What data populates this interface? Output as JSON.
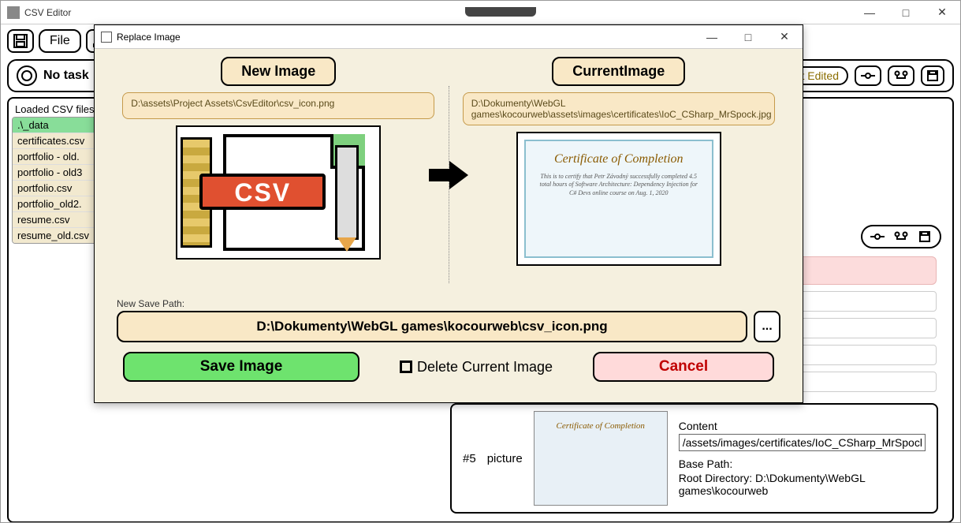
{
  "window": {
    "title": "CSV Editor",
    "min": "—",
    "max": "□",
    "close": "✕"
  },
  "toolbar": {
    "save_icon": "💾",
    "file_label": "File",
    "edit_icon": "✎"
  },
  "taskbar": {
    "text": "No task",
    "not_edited": "Not Edited"
  },
  "sidebar": {
    "title": "Loaded CSV files",
    "items": [
      ".\\_data",
      "certificates.csv",
      "portfolio - old.",
      "portfolio - old3",
      "portfolio.csv",
      "portfolio_old2.",
      "resume.csv",
      "resume_old.csv"
    ]
  },
  "detail": {
    "index": "#5",
    "type": "picture",
    "content_label": "Content",
    "content_value": "/assets/images/certificates/IoC_CSharp_MrSpock.jpg",
    "base_path_label": "Base Path:",
    "root_label": "Root Directory: D:\\Dokumenty\\WebGL games\\kocourweb"
  },
  "modal": {
    "title": "Replace Image",
    "new_image_btn": "New Image",
    "current_image_btn": "CurrentImage",
    "new_path": "D:\\assets\\Project Assets\\CsvEditor\\csv_icon.png",
    "current_path": "D:\\Dokumenty\\WebGL games\\kocourweb\\assets\\images\\certificates\\IoC_CSharp_MrSpock.jpg",
    "csv_tag": "CSV",
    "cert_title": "Certificate of Completion",
    "cert_body": "This is to certify that Petr Závodný successfully completed 4.5 total hours of Software Architecture: Dependency Injection for C# Devs online course on Aug. 1, 2020",
    "new_save_label": "New Save Path:",
    "new_save_value": "D:\\Dokumenty\\WebGL games\\kocourweb\\csv_icon.png",
    "browse": "...",
    "save_btn": "Save Image",
    "delete_chk": "Delete Current Image",
    "cancel_btn": "Cancel",
    "min": "—",
    "max": "□",
    "close": "✕"
  }
}
